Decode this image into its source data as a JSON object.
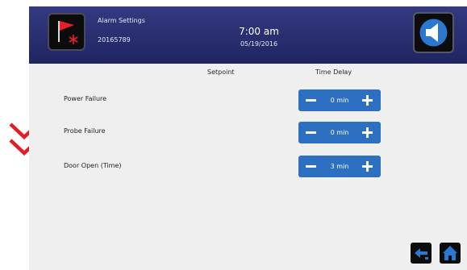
{
  "header": {
    "title": "Alarm Settings",
    "device_id": "20165789",
    "time": "7:00 am",
    "date": "05/19/2016"
  },
  "columns": {
    "setpoint": "Setpoint",
    "time_delay": "Time Delay"
  },
  "rows": [
    {
      "label": "Power Failure",
      "delay": "0 min"
    },
    {
      "label": "Probe Failure",
      "delay": "0 min"
    },
    {
      "label": "Door Open (Time)",
      "delay": "3 min"
    }
  ],
  "icons": {
    "alarm": "alarm-flag-snowflake-icon",
    "sound": "speaker-icon",
    "scroll_indicator": "double-chevron-down-icon",
    "back": "back-arrow-icon",
    "home": "home-icon"
  },
  "colors": {
    "header": "#262b6e",
    "stepper": "#2d6fc1",
    "scroll_indicator": "#e41e25",
    "nav_icon": "#2b78d0"
  }
}
